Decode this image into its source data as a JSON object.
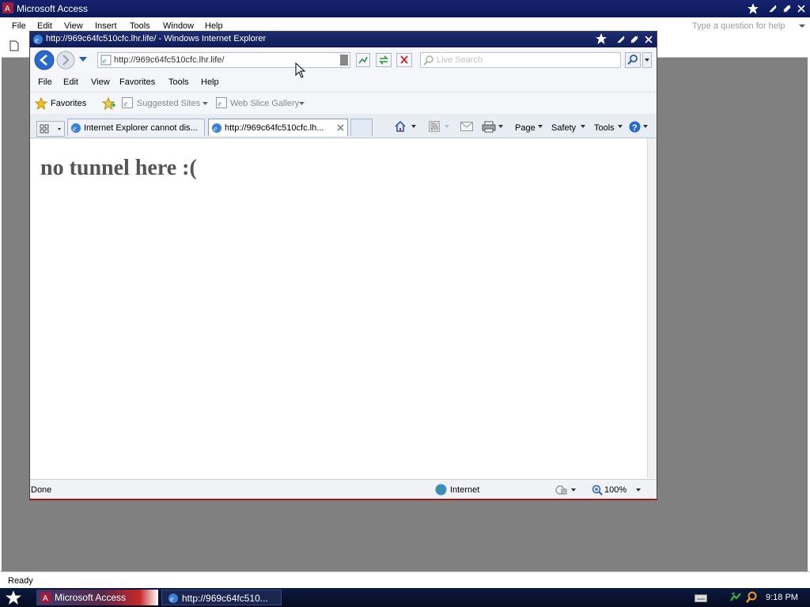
{
  "access": {
    "title": "Microsoft Access",
    "menu": [
      "File",
      "Edit",
      "View",
      "Insert",
      "Tools",
      "Window",
      "Help"
    ],
    "ask_placeholder": "Type a question for help",
    "status": "Ready"
  },
  "ie": {
    "title": "http://969c64fc510cfc.lhr.life/ - Windows Internet Explorer",
    "address": "http://969c64fc510cfc.lhr.life/",
    "search_placeholder": "Live Search",
    "menu": [
      "File",
      "Edit",
      "View",
      "Favorites",
      "Tools",
      "Help"
    ],
    "favorites_label": "Favorites",
    "suggested_sites": "Suggested Sites",
    "web_slice_gallery": "Web Slice Gallery",
    "tabs": [
      {
        "label": "Internet Explorer cannot dis...",
        "active": false
      },
      {
        "label": "http://969c64fc510cfc.lh...",
        "active": true
      }
    ],
    "commands": {
      "page": "Page",
      "safety": "Safety",
      "tools": "Tools"
    },
    "page_heading": "no tunnel here :(",
    "status_left": "Done",
    "zone": "Internet",
    "zoom": "100%"
  },
  "taskbar": {
    "items": [
      "Microsoft Access",
      "http://969c64fc510..."
    ],
    "clock": "9:18 PM"
  }
}
